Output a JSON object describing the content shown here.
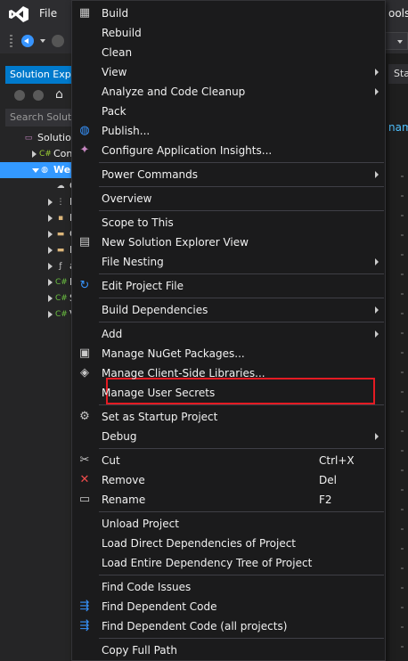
{
  "titlebar": {
    "file_menu": "File",
    "tools_menu_partial": "ools"
  },
  "solution_explorer": {
    "tab_label": "Solution Expl",
    "search_placeholder": "Search Solutio",
    "tree": [
      {
        "label": "Solution",
        "icon": "solution-icon",
        "level": 0,
        "expander": "none"
      },
      {
        "label": "Con",
        "icon": "csharp-project-icon",
        "level": 1,
        "expander": "collapsed"
      },
      {
        "label": "Web",
        "icon": "web-project-icon",
        "level": 1,
        "expander": "expanded",
        "selected": true
      },
      {
        "label": "C",
        "icon": "connected-services-icon",
        "level": 2,
        "expander": "none"
      },
      {
        "label": "D",
        "icon": "dependencies-icon",
        "level": 2,
        "expander": "collapsed"
      },
      {
        "label": "P",
        "icon": "properties-icon",
        "level": 2,
        "expander": "collapsed"
      },
      {
        "label": "C",
        "icon": "folder-icon",
        "level": 2,
        "expander": "collapsed"
      },
      {
        "label": "M",
        "icon": "folder-icon",
        "level": 2,
        "expander": "collapsed"
      },
      {
        "label": "a",
        "icon": "config-file-icon",
        "level": 2,
        "expander": "collapsed"
      },
      {
        "label": "P",
        "icon": "csharp-file-icon",
        "level": 2,
        "expander": "collapsed"
      },
      {
        "label": "S",
        "icon": "csharp-file-icon",
        "level": 2,
        "expander": "collapsed"
      },
      {
        "label": "V",
        "icon": "csharp-file-icon",
        "level": 2,
        "expander": "collapsed"
      }
    ]
  },
  "editor": {
    "tab_partial": "Sta",
    "text_partial": "nam"
  },
  "context_menu": {
    "items": [
      {
        "label": "Build",
        "icon": "build-icon"
      },
      {
        "label": "Rebuild"
      },
      {
        "label": "Clean"
      },
      {
        "label": "View",
        "submenu": true
      },
      {
        "label": "Analyze and Code Cleanup",
        "submenu": true
      },
      {
        "label": "Pack"
      },
      {
        "label": "Publish...",
        "icon": "globe-publish-icon"
      },
      {
        "label": "Configure Application Insights...",
        "icon": "lightbulb-insights-icon"
      },
      {
        "separator": true
      },
      {
        "label": "Power Commands",
        "submenu": true
      },
      {
        "separator": true
      },
      {
        "label": "Overview"
      },
      {
        "separator": true
      },
      {
        "label": "Scope to This"
      },
      {
        "label": "New Solution Explorer View",
        "icon": "new-window-icon"
      },
      {
        "label": "File Nesting",
        "submenu": true
      },
      {
        "separator": true
      },
      {
        "label": "Edit Project File",
        "icon": "edit-refresh-icon"
      },
      {
        "separator": true
      },
      {
        "label": "Build Dependencies",
        "submenu": true
      },
      {
        "separator": true
      },
      {
        "label": "Add",
        "submenu": true
      },
      {
        "label": "Manage NuGet Packages...",
        "icon": "nuget-package-icon"
      },
      {
        "label": "Manage Client-Side Libraries...",
        "icon": "client-libraries-icon"
      },
      {
        "label": "Manage User Secrets"
      },
      {
        "separator": true
      },
      {
        "label": "Set as Startup Project",
        "icon": "gear-icon"
      },
      {
        "label": "Debug",
        "submenu": true
      },
      {
        "separator": true
      },
      {
        "label": "Cut",
        "icon": "scissors-icon",
        "shortcut": "Ctrl+X"
      },
      {
        "label": "Remove",
        "icon": "remove-x-icon",
        "shortcut": "Del"
      },
      {
        "label": "Rename",
        "icon": "rename-icon",
        "shortcut": "F2"
      },
      {
        "separator": true
      },
      {
        "label": "Unload Project"
      },
      {
        "label": "Load Direct Dependencies of Project"
      },
      {
        "label": "Load Entire Dependency Tree of Project"
      },
      {
        "separator": true
      },
      {
        "label": "Find Code Issues"
      },
      {
        "label": "Find Dependent Code",
        "icon": "find-dependent-icon"
      },
      {
        "label": "Find Dependent Code (all projects)",
        "icon": "find-dependent-icon"
      },
      {
        "separator": true
      },
      {
        "label": "Copy Full Path"
      }
    ]
  },
  "annotation": {
    "highlighted_item": "Manage User Secrets",
    "color": "#e41b23"
  },
  "colors": {
    "accent": "#007acc",
    "selection": "#3399ff",
    "menu_bg": "#1b1b1c"
  }
}
